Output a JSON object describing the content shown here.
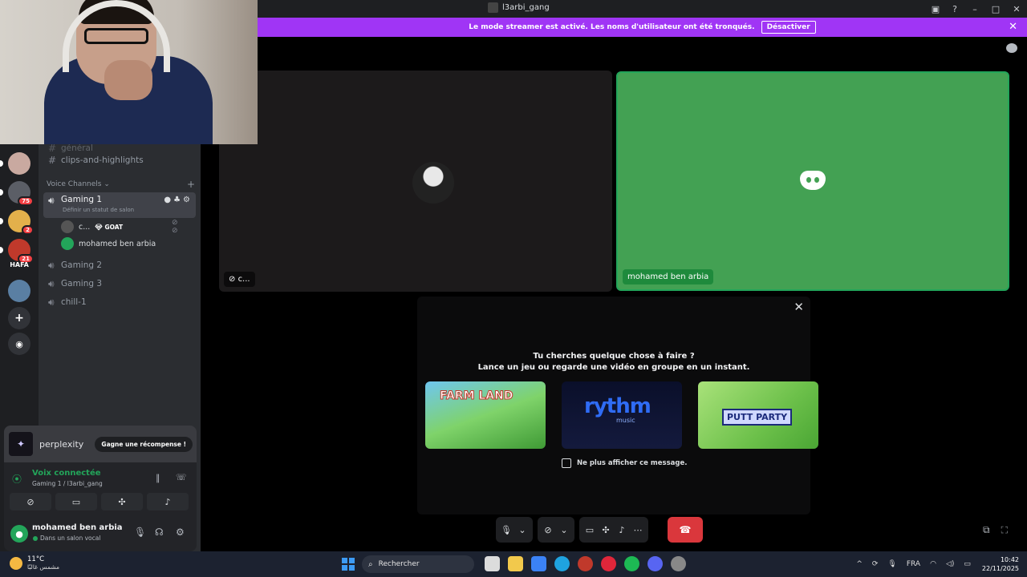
{
  "window": {
    "title": "l3arbi_gang"
  },
  "banner": {
    "text": "Le mode streamer est activé. Les noms d'utilisateur ont été tronqués.",
    "button": "Désactiver"
  },
  "channels": {
    "top_partial": "général",
    "text_channel": "clips-and-highlights",
    "category": "Voice Channels",
    "voice": [
      {
        "name": "Gaming 1",
        "status": "Définir un statut de salon"
      },
      {
        "name": "Gaming 2"
      },
      {
        "name": "Gaming 3"
      },
      {
        "name": "chill-1"
      }
    ],
    "members": [
      {
        "name": "c...",
        "badge": "GOAT"
      },
      {
        "name": "mohamed ben arbia"
      }
    ]
  },
  "guilds": [
    {
      "badge": "75"
    },
    {
      "badge": "2"
    },
    {
      "badge": "21"
    },
    {
      "label": "HAFA"
    }
  ],
  "promo": {
    "name": "perplexity",
    "button": "Gagne une récompense !"
  },
  "voice_panel": {
    "title": "Voix connectée",
    "subtitle": "Gaming 1 / l3arbi_gang"
  },
  "user": {
    "name": "mohamed ben arbia",
    "status": "Dans un salon vocal"
  },
  "stage": {
    "tile1_label": "c...",
    "tile2_label": "mohamed ben arbia"
  },
  "activity": {
    "heading1": "Tu cherches quelque chose à faire ?",
    "heading2": "Lance un jeu ou regarde une vidéo en groupe en un instant.",
    "cards": [
      {
        "title": "FARM LAND"
      },
      {
        "title": "rythm",
        "subtitle": "music"
      },
      {
        "title": "PUTT PARTY"
      }
    ],
    "checkbox": "Ne plus afficher ce message."
  },
  "taskbar": {
    "temp": "11°C",
    "weather": "مشمس غالبًا",
    "search": "Rechercher",
    "lang": "FRA",
    "time": "10:42",
    "date": "22/11/2025"
  }
}
